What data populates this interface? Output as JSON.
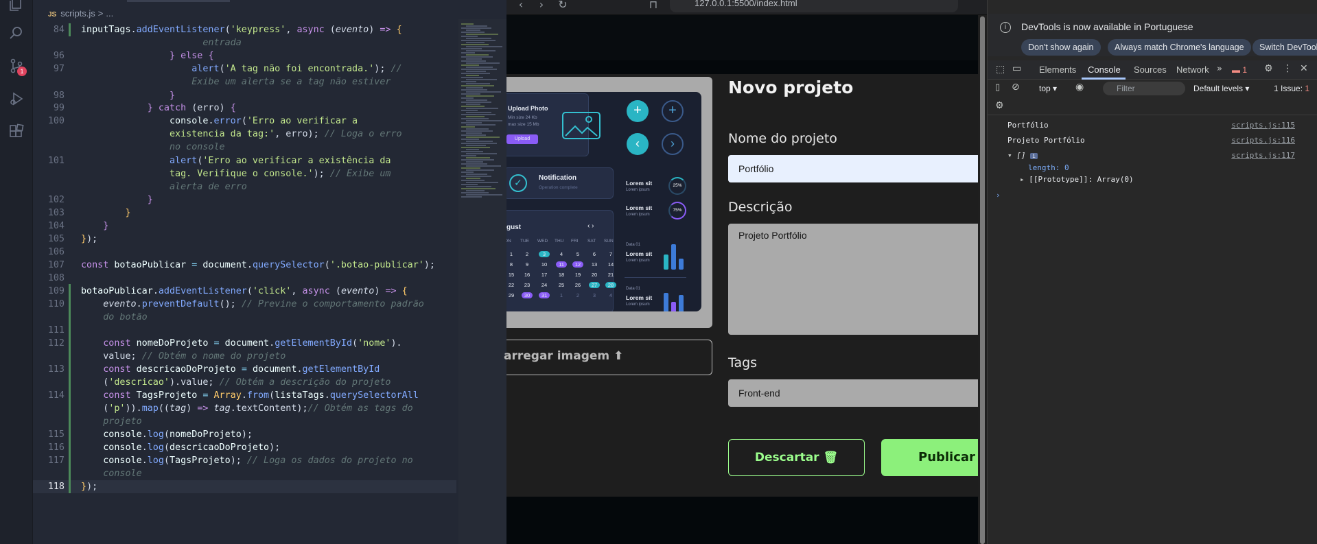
{
  "editor": {
    "breadcrumb": {
      "js_label": "JS",
      "file": "scripts.js",
      "sep": ">",
      "more": "..."
    },
    "lines": [
      {
        "n": "84",
        "html": "<span class='vr'>inputTags</span>.<span class='fn'>addEventListener</span>(<span class='st'>'keypress'</span>, <span class='kw'>async</span> (<span class='it'>evento</span>) <span class='kw'>=&gt;</span> <span class='pn'>{</span>"
      },
      {
        "n": "",
        "html": "                      <span class='cm'>entrada</span>"
      },
      {
        "n": "96",
        "html": "                <span class='pn2'>}</span> <span class='kw'>else</span> <span class='pn2'>{</span>"
      },
      {
        "n": "97",
        "html": "                    <span class='fn'>alert</span>(<span class='st'>'A tag não foi encontrada.'</span>); <span class='cm'>//</span>"
      },
      {
        "n": "",
        "html": "                    <span class='cm'>Exibe um alerta se a tag não estiver</span>"
      },
      {
        "n": "98",
        "html": "                <span class='pn2'>}</span>"
      },
      {
        "n": "99",
        "html": "            <span class='pn2'>}</span> <span class='kw'>catch</span> (erro) <span class='pn2'>{</span>"
      },
      {
        "n": "100",
        "html": "                <span class='vr'>console</span>.<span class='fn'>error</span>(<span class='st'>'Erro ao verificar a</span>"
      },
      {
        "n": "",
        "html": "                <span class='st'>existencia da tag:'</span>, erro); <span class='cm'>// Loga o erro</span>"
      },
      {
        "n": "",
        "html": "                <span class='cm'>no console</span>"
      },
      {
        "n": "101",
        "html": "                <span class='fn'>alert</span>(<span class='st'>'Erro ao verificar a existência da</span>"
      },
      {
        "n": "",
        "html": "                <span class='st'>tag. Verifique o console.'</span>); <span class='cm'>// Exibe um</span>"
      },
      {
        "n": "",
        "html": "                <span class='cm'>alerta de erro</span>"
      },
      {
        "n": "102",
        "html": "            <span class='pn2'>}</span>"
      },
      {
        "n": "103",
        "html": "        <span class='pn'>}</span>"
      },
      {
        "n": "104",
        "html": "    <span class='pn2'>}</span>"
      },
      {
        "n": "105",
        "html": "<span class='pn'>}</span>);"
      },
      {
        "n": "106",
        "html": ""
      },
      {
        "n": "107",
        "html": "<span class='kw'>const</span> <span class='vr'>botaoPublicar</span> <span class='op'>=</span> <span class='vr'>document</span>.<span class='fn'>querySelector</span>(<span class='st'>'.botao-publicar'</span>);"
      },
      {
        "n": "108",
        "html": ""
      },
      {
        "n": "109",
        "html": "<span class='vr'>botaoPublicar</span>.<span class='fn'>addEventListener</span>(<span class='st'>'click'</span>, <span class='kw'>async</span> (<span class='it'>evento</span>) <span class='kw'>=&gt;</span> <span class='pn'>{</span>"
      },
      {
        "n": "110",
        "html": "    <span class='it'>evento</span>.<span class='fn'>preventDefault</span>(); <span class='cm'>// Previne o comportamento padrão</span>"
      },
      {
        "n": "",
        "html": "    <span class='cm'>do botão</span>"
      },
      {
        "n": "111",
        "html": ""
      },
      {
        "n": "112",
        "html": "    <span class='kw'>const</span> <span class='vr'>nomeDoProjeto</span> <span class='op'>=</span> <span class='vr'>document</span>.<span class='fn'>getElementById</span>(<span class='st'>'nome'</span>)."
      },
      {
        "n": "",
        "html": "    value; <span class='cm'>// Obtém o nome do projeto</span>"
      },
      {
        "n": "113",
        "html": "    <span class='kw'>const</span> <span class='vr'>descricaoDoProjeto</span> <span class='op'>=</span> <span class='vr'>document</span>.<span class='fn'>getElementById</span>"
      },
      {
        "n": "",
        "html": "    (<span class='st'>'descricao'</span>).value; <span class='cm'>// Obtém a descrição do projeto</span>"
      },
      {
        "n": "114",
        "html": "    <span class='kw'>const</span> <span class='vr'>TagsProjeto</span> <span class='op'>=</span> <span class='cl'>Array</span>.<span class='fn'>from</span>(<span class='vr'>listaTags</span>.<span class='fn'>querySelectorAll</span>"
      },
      {
        "n": "",
        "html": "    (<span class='st'>'p'</span>)).<span class='fn'>map</span>((<span class='it'>tag</span>) <span class='kw'>=&gt;</span> <span class='it'>tag</span>.textContent);<span class='cm'>// Obtém as tags do</span>"
      },
      {
        "n": "",
        "html": "    <span class='cm'>projeto</span>"
      },
      {
        "n": "115",
        "html": "    <span class='vr'>console</span>.<span class='fn'>log</span>(<span class='vr'>nomeDoProjeto</span>);"
      },
      {
        "n": "116",
        "html": "    <span class='vr'>console</span>.<span class='fn'>log</span>(<span class='vr'>descricaoDoProjeto</span>);"
      },
      {
        "n": "117",
        "html": "    <span class='vr'>console</span>.<span class='fn'>log</span>(<span class='vr'>TagsProjeto</span>); <span class='cm'>// Loga os dados do projeto no</span>"
      },
      {
        "n": "",
        "html": "    <span class='cm'>console</span>"
      },
      {
        "n": "118",
        "html": "<span class='pn'>}</span>);"
      }
    ],
    "badge": "1"
  },
  "browser": {
    "url": "127.0.0.1:5500/index.html",
    "mock": {
      "upload_title": "Upload Photo",
      "upload_sub1": "Min size 24 Kb",
      "upload_sub2": "max size 15 Mb",
      "upload_btn": "Upload",
      "notif_title": "Notification",
      "notif_sub": "Operation complete",
      "lorem1": "Lorem sit",
      "lorem_sub": "Lorem ipsum",
      "pct1": "25%",
      "pct2": "75%",
      "cal_month": "gust",
      "cal_days": [
        "ON",
        "TUE",
        "WED",
        "THU",
        "FRI",
        "SAT",
        "SUN"
      ],
      "cal_rows": [
        [
          "1",
          "2",
          "3",
          "4",
          "5",
          "6",
          "7"
        ],
        [
          "8",
          "9",
          "10",
          "11",
          "12",
          "13",
          "14"
        ],
        [
          "15",
          "16",
          "17",
          "18",
          "19",
          "20",
          "21"
        ],
        [
          "22",
          "23",
          "24",
          "25",
          "26",
          "27",
          "28"
        ],
        [
          "29",
          "30",
          "31",
          "1",
          "2",
          "3",
          "4"
        ]
      ],
      "data_label": "Data 01"
    },
    "upload_label": "arregar imagem",
    "title": "Novo projeto",
    "name_label": "Nome do projeto",
    "name_value": "Portfólio",
    "desc_label": "Descrição",
    "desc_value": "Projeto Portfólio",
    "tags_label": "Tags",
    "tags_value": "Front-end",
    "discard_label": "Descartar",
    "publish_label": "Publicar"
  },
  "devtools": {
    "info": "DevTools is now available in Portuguese",
    "btn1": "Don't show again",
    "btn2": "Always match Chrome's language",
    "btn3": "Switch DevTool",
    "tabs": [
      "Elements",
      "Console",
      "Sources",
      "Network"
    ],
    "err_count": "1",
    "context": "top",
    "filter_placeholder": "Filter",
    "levels": "Default levels",
    "issues": "1 Issue:",
    "issue_count": "1",
    "logs": [
      {
        "msg": "Portfólio",
        "src": "scripts.js:115"
      },
      {
        "msg": "Projeto Portfólio",
        "src": "scripts.js:116"
      },
      {
        "msg": "[]",
        "src": "scripts.js:117"
      }
    ],
    "length_line": "length: 0",
    "proto_line": "[[Prototype]]: Array(0)"
  }
}
